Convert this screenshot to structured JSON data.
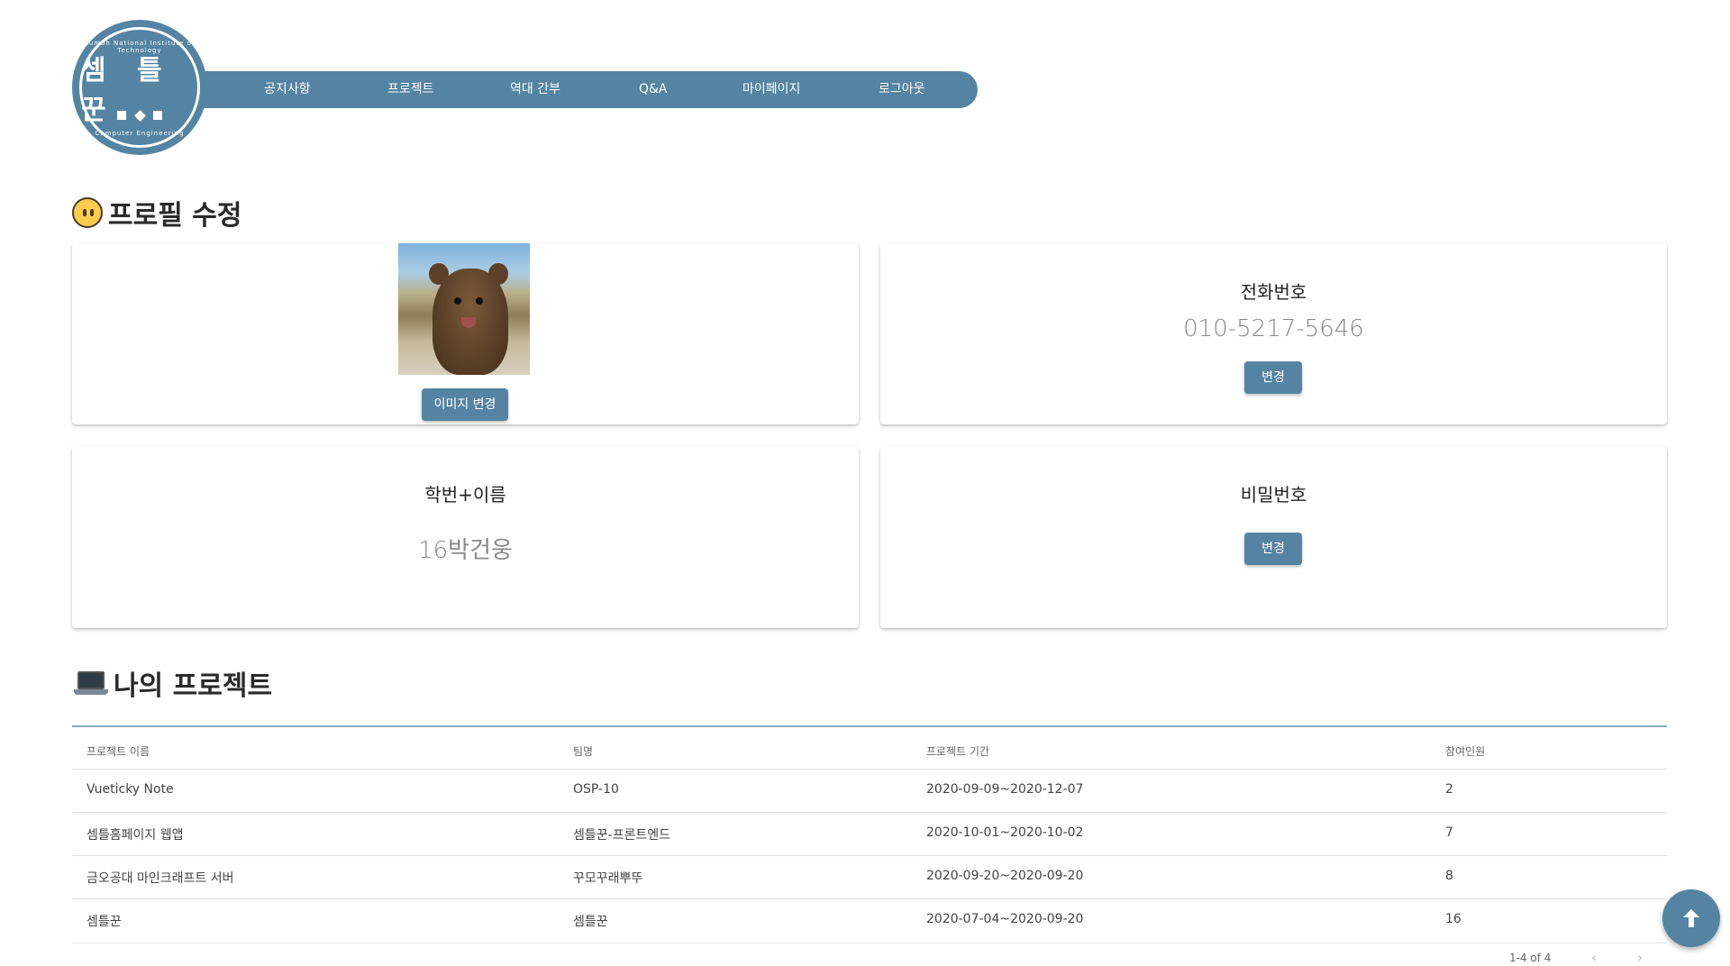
{
  "logo": {
    "text": "셈 틀 꾼",
    "top_text": "Kumoh National Institute of Technology",
    "bottom_text": "Computer Engineering"
  },
  "nav": {
    "items": [
      {
        "label": "공지사항"
      },
      {
        "label": "프로젝트"
      },
      {
        "label": "역대 간부"
      },
      {
        "label": "Q&A"
      },
      {
        "label": "마이페이지"
      },
      {
        "label": "로그아웃"
      }
    ]
  },
  "profile": {
    "title": "프로필 수정",
    "image_button": "이미지 변경",
    "phone": {
      "label": "전화번호",
      "value": "010-5217-5646",
      "button": "변경"
    },
    "student": {
      "label": "학번+이름",
      "value": "16박건웅"
    },
    "password": {
      "label": "비밀번호",
      "button": "변경"
    }
  },
  "projects": {
    "title": "나의 프로젝트",
    "headers": [
      "프로젝트 이름",
      "팀명",
      "프로젝트 기간",
      "참여인원"
    ],
    "rows": [
      [
        "Vueticky Note",
        "OSP-10",
        "2020-09-09~2020-12-07",
        "2"
      ],
      [
        "셈틀홈페이지 웹앱",
        "셈틀꾼-프론트엔드",
        "2020-10-01~2020-10-02",
        "7"
      ],
      [
        "금오공대 마인크래프트 서버",
        "꾸모꾸래뿌뚜",
        "2020-09-20~2020-09-20",
        "8"
      ],
      [
        "셈틀꾼",
        "셈틀꾼",
        "2020-07-04~2020-09-20",
        "16"
      ]
    ],
    "pagination": "1-4 of 4"
  },
  "icons": {
    "profile_title": "neutral-face-icon",
    "projects_title": "laptop-icon",
    "fab": "arrow-up-icon",
    "prev": "chevron-left-icon",
    "next": "chevron-right-icon"
  },
  "colors": {
    "primary": "#5584a3"
  }
}
